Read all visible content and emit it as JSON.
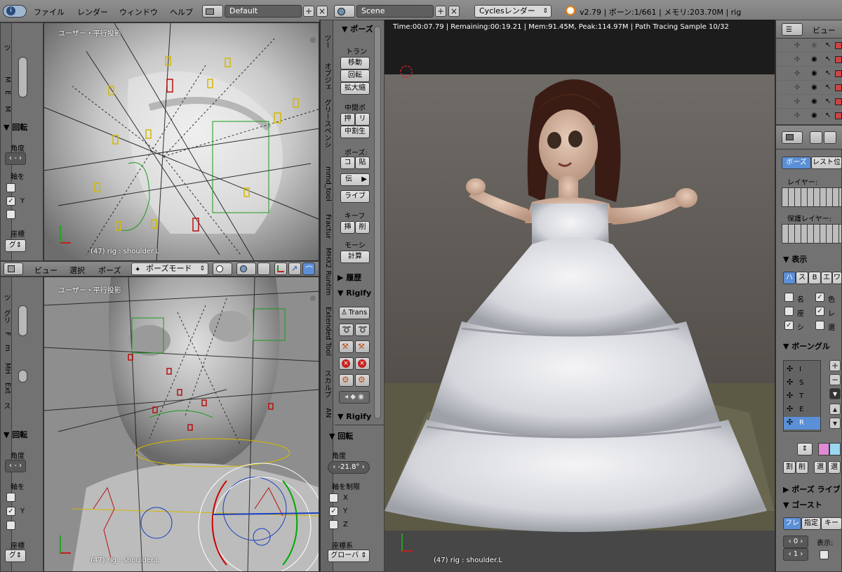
{
  "topbar": {
    "menus": [
      "ファイル",
      "レンダー",
      "ウィンドウ",
      "ヘルプ"
    ],
    "layout": "Default",
    "scene": "Scene",
    "engine": "Cyclesレンダー",
    "stats": "v2.79 | ボーン:1/661 | メモリ:203.70M | rig"
  },
  "vp_top": {
    "title": "ユーザー・平行投影",
    "status": "(47) rig : shoulder.L"
  },
  "vp_bottom": {
    "title": "ユーザー・平行投影",
    "status": "(47) rig : shoulder.L"
  },
  "vp_header": {
    "menus": [
      "ビュー",
      "選択",
      "ポーズ"
    ],
    "mode": "ポーズモード"
  },
  "left_top": {
    "rot_header": "回転",
    "angle_label": "角度",
    "axis_label": "軸を",
    "y": "Y",
    "coord_label": "座標",
    "coord_value": "グ"
  },
  "left_top_tabs": [
    "ツ",
    "M",
    "E",
    "M"
  ],
  "left_bottom": {
    "rot_header": "回転",
    "angle_label": "角度",
    "axis_label": "軸を",
    "y": "Y",
    "coord_label": "座標",
    "coord_value": "グ"
  },
  "left_bottom_tabs": [
    "ツ",
    "グリ",
    "F",
    "m",
    "MH",
    "Ext",
    "ス"
  ],
  "tool_tabs": [
    "ツー",
    "オブジェ",
    "グリースペンシ",
    "mmd_tool",
    "Fractur",
    "MHX2 Runtim",
    "Extended Tool",
    "スカルプ",
    "AN"
  ],
  "tools": {
    "pose_header": "ポーズ",
    "transform": "トラン",
    "move": "移動",
    "rotate": "回転",
    "scale": "拡大縮",
    "inbetween": "中間ポ",
    "push": "押",
    "relax": "リ",
    "breakdown": "中割生",
    "pose_label": "ポーズ:",
    "copy": "コ",
    "paste": "貼",
    "propagate": "伝",
    "library": "ライブ",
    "keyframe": "キーフ",
    "insert": "挿",
    "delete": "削",
    "motion": "モーシ",
    "calc": "計算",
    "history": "履歴",
    "rigify": "Rigify",
    "trans": "Trans",
    "rigify2": "Rigify",
    "rot_header": "回転",
    "angle_label": "角度",
    "angle_value": "-21.8°",
    "constraint_label": "軸を制限",
    "x": "X",
    "y": "Y",
    "z": "Z",
    "coord_label": "座標系",
    "coord_value": "グローバ"
  },
  "render": {
    "info": "Time:00:07.79 | Remaining:00:19.21 | Mem:91.45M, Peak:114.97M | Path Tracing Sample 10/32",
    "status": "(47) rig : shoulder.L"
  },
  "outliner": {
    "view": "ビュー"
  },
  "props": {
    "tab_pose": "ボーズ",
    "tab_rest": "レスト位",
    "layers": "レイヤー:",
    "protected_layers": "保護レイヤー:",
    "display": "表示",
    "display_tabs": [
      "ハ",
      "ス",
      "B",
      "エ",
      "ワ"
    ],
    "opt_name": "名",
    "opt_color": "色",
    "opt_axes": "座",
    "opt_x": "レ",
    "opt_shape": "シ",
    "opt_sel": "選",
    "bone_groups": "ボーングル",
    "groups": [
      "I",
      "S",
      "T",
      "E",
      "R"
    ],
    "assign": "割",
    "remove": "削",
    "select": "選",
    "deselect": "選",
    "pose_library": "ポーズ ライブ",
    "ghost": "ゴースト",
    "ghost_tabs": [
      "フレ",
      "指定",
      "キー"
    ],
    "ghost_val1": "0",
    "ghost_val2": "1",
    "display_label": "表示:"
  }
}
